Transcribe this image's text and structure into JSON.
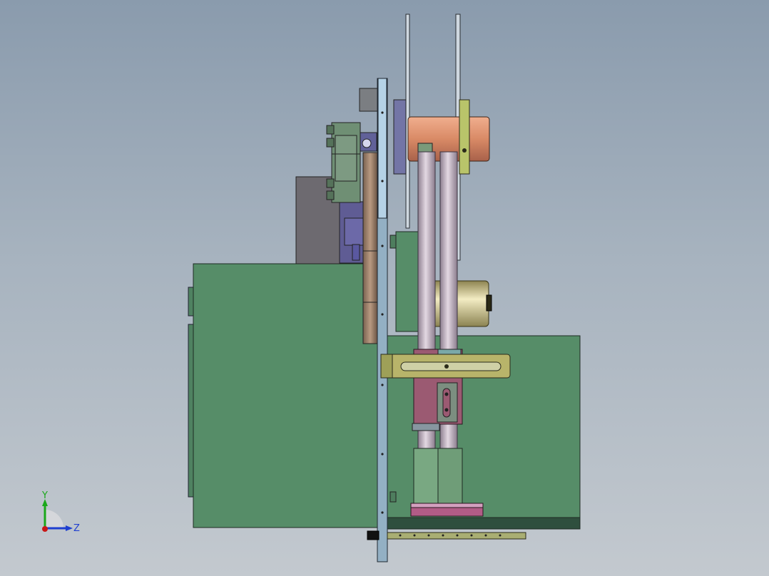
{
  "triad": {
    "y_label": "Y",
    "z_label": "Z",
    "y_color": "#1aa81a",
    "z_color": "#1f3fd0",
    "x_color": "#c81818"
  },
  "colors": {
    "background_top": "#8a9bad",
    "background_bottom": "#c3c9cf",
    "housing_green": "#568d68",
    "dark_green": "#2f4f3e",
    "plate_blue": "#a8c4d8",
    "copper_roller": "#d58b6c",
    "rod_lavender": "#b9a8b8",
    "bracket_olive": "#b8b46a",
    "slider_pink": "#9b5a72",
    "motor_gold": "#cbbf86",
    "fitting_green": "#6f8f74"
  }
}
